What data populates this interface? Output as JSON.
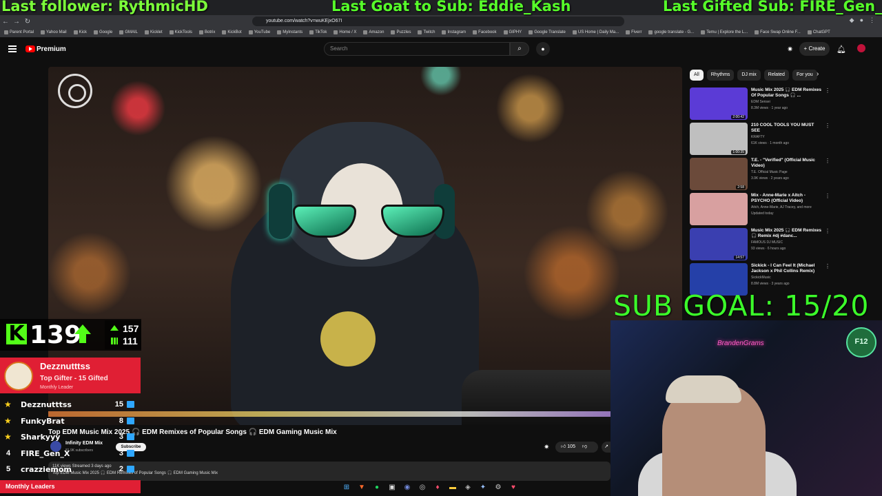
{
  "overlay": {
    "last_follower": "Last follower: RythmicHD",
    "last_goat": "Last Goat to Sub: Eddie_Kash",
    "last_gifted": "Last Gifted Sub: FIRE_Gen_X",
    "sub_goal": "SUB GOAL: 15/20"
  },
  "browser": {
    "url": "youtube.com/watch?v=wuKEjxO67I",
    "bookmarks": [
      "Parent Portal",
      "Yahoo Mail",
      "Kick",
      "Google",
      "GMAIL",
      "Kicklet",
      "KickTools",
      "Botrix",
      "KickBot",
      "YouTube",
      "MyInstants",
      "TikTok",
      "Home / X",
      "Amazon",
      "Puzzles",
      "Twitch",
      "Instagram",
      "Facebook",
      "GIPHY",
      "Google Translate",
      "US Home | Daily Ma...",
      "Fiverr",
      "google translate - G...",
      "Temu | Explore the L...",
      "Face Swap Online F...",
      "ChatGPT"
    ]
  },
  "header": {
    "brand": "Premium",
    "search_placeholder": "Search",
    "create_label": "Create"
  },
  "video": {
    "title": "Top EDM Music Mix 2025 🎧 EDM Remixes of Popular Songs 🎧 EDM Gaming Music Mix",
    "channel": "Infinity EDM Mix",
    "subscribers": "81.9K subscribers",
    "subscribe_label": "Subscribe",
    "likes": "105",
    "stats": "11K views  Streamed 3 days ago",
    "description": "Top EDM Music Mix 2025 🎧 EDM Remixes of Popular Songs 🎧 EDM Gaming Music Mix"
  },
  "sidebar": {
    "chips": [
      "All",
      "Rhythms",
      "DJ mix",
      "Related",
      "For you"
    ],
    "recs": [
      {
        "title": "Music Mix 2025 🎧 EDM Remixes Of Popular Songs 🎧 ...",
        "channel": "EDM Sensei",
        "meta": "8.3M views · 1 year ago",
        "duration": "2:00:42",
        "color": "#5b3bd6"
      },
      {
        "title": "210 COOL TOOLS YOU MUST SEE",
        "channel": "KRAFTY",
        "meta": "61K views · 1 month ago",
        "duration": "1:00:35",
        "color": "#bfbfbf"
      },
      {
        "title": "T.E. - \"Verified\" (Official Music Video)",
        "channel": "T.E. Official Music Page",
        "meta": "3.9K views · 2 years ago",
        "duration": "2:58",
        "color": "#6b4a3a"
      },
      {
        "title": "Mix - Anne-Marie x Aitch - PSYCHO (Official Video)",
        "channel": "Aitch, Anne-Marie, AJ Tracey, and more",
        "meta": "Updated today",
        "duration": "",
        "color": "#d8a0a0"
      },
      {
        "title": "Music Mix 2025 🎧 EDM Remixes 🎧 Remix #dj #danc...",
        "channel": "FAMOUS DJ MUSIC",
        "meta": "93 views · 6 hours ago",
        "duration": "14:57",
        "color": "#3a3fb0"
      },
      {
        "title": "Sickick - I Can Feel It (Michael Jackson x Phil Collins Remix)",
        "channel": "SickickMusic",
        "meta": "8.8M views · 3 years ago",
        "duration": "",
        "color": "#2540a8"
      }
    ]
  },
  "kick": {
    "followers": "139",
    "stat_a": "157",
    "stat_b": "111"
  },
  "leaderboard": {
    "top_name": "Dezznutttss",
    "top_sub": "Top Gifter - 15 Gifted",
    "top_role": "Monthly Leader",
    "rows": [
      {
        "rank": "★",
        "name": "Dezznutttss",
        "value": "15"
      },
      {
        "rank": "★",
        "name": "FunkyBrat",
        "value": "8"
      },
      {
        "rank": "★",
        "name": "Sharkyyy",
        "value": "3"
      },
      {
        "rank": "4",
        "name": "FIRE_Gen_X",
        "value": "3"
      },
      {
        "rank": "5",
        "name": "crazziemom",
        "value": "2"
      }
    ],
    "footer": "Monthly Leaders"
  },
  "webcam": {
    "neon": "BrandenGrams"
  },
  "colors": {
    "accent_green": "#53fc18",
    "leader_red": "#e01f34",
    "youtube_red": "#ff0000"
  }
}
